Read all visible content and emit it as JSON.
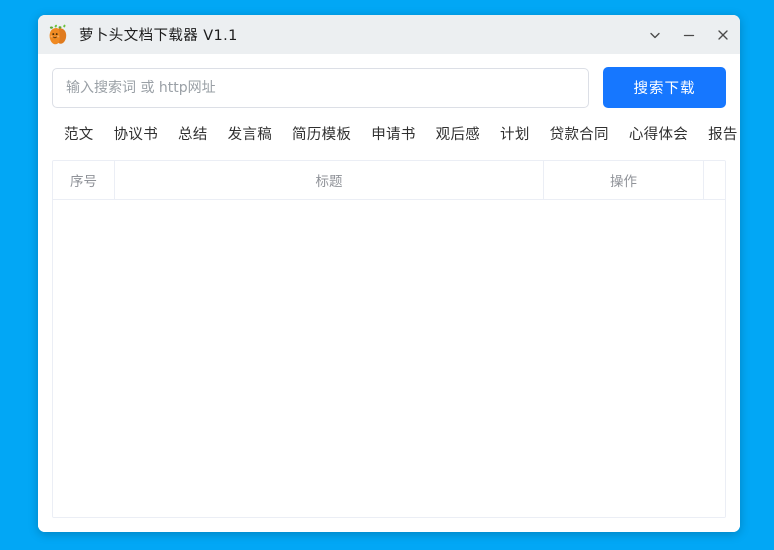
{
  "desktop": {
    "background_color": "#02a7f5"
  },
  "window": {
    "title": "萝卜头文档下载器  V1.1",
    "icon": "carrot-icon",
    "titlebar_color": "#eceff1",
    "controls": [
      {
        "name": "minimize-to-tray-button",
        "icon": "chevron-down-icon",
        "label": ""
      },
      {
        "name": "minimize-button",
        "icon": "minus-icon",
        "label": ""
      },
      {
        "name": "close-button",
        "icon": "close-icon",
        "label": ""
      }
    ]
  },
  "search": {
    "placeholder": "输入搜索词 或 http网址",
    "value": "",
    "button_label": "搜索下载",
    "button_color": "#1677ff"
  },
  "tags": [
    {
      "label": "范文"
    },
    {
      "label": "协议书"
    },
    {
      "label": "总结"
    },
    {
      "label": "发言稿"
    },
    {
      "label": "简历模板"
    },
    {
      "label": "申请书"
    },
    {
      "label": "观后感"
    },
    {
      "label": "计划"
    },
    {
      "label": "贷款合同"
    },
    {
      "label": "心得体会"
    },
    {
      "label": "报告"
    }
  ],
  "table": {
    "columns": [
      {
        "key": "index",
        "label": "序号"
      },
      {
        "key": "title",
        "label": "标题"
      },
      {
        "key": "action",
        "label": "操作"
      }
    ],
    "rows": []
  }
}
